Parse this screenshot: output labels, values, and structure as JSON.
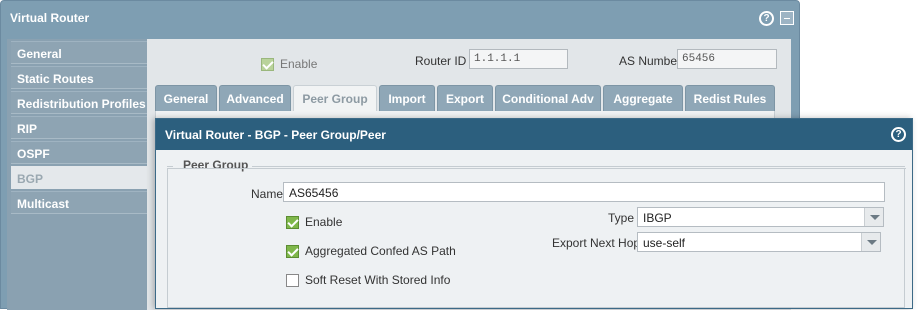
{
  "window": {
    "title": "Virtual Router"
  },
  "sidebar": {
    "items": [
      {
        "label": "General"
      },
      {
        "label": "Static Routes"
      },
      {
        "label": "Redistribution Profiles"
      },
      {
        "label": "RIP"
      },
      {
        "label": "OSPF"
      },
      {
        "label": "BGP"
      },
      {
        "label": "Multicast"
      }
    ],
    "active": "BGP"
  },
  "bgp_settings": {
    "enable_label": "Enable",
    "enable_checked": true,
    "router_id_label": "Router ID",
    "router_id_value": "1.1.1.1",
    "as_number_label": "AS Number",
    "as_number_value": "65456"
  },
  "tabs": [
    {
      "label": "General"
    },
    {
      "label": "Advanced"
    },
    {
      "label": "Peer Group"
    },
    {
      "label": "Import"
    },
    {
      "label": "Export"
    },
    {
      "label": "Conditional Adv"
    },
    {
      "label": "Aggregate"
    },
    {
      "label": "Redist Rules"
    }
  ],
  "active_tab": "Peer Group",
  "dialog": {
    "title": "Virtual Router - BGP - Peer Group/Peer",
    "section_title": "Peer Group",
    "name_label": "Name",
    "name_value": "AS65456",
    "enable_label": "Enable",
    "enable_checked": true,
    "aggregated_label": "Aggregated Confed AS Path",
    "aggregated_checked": true,
    "soft_reset_label": "Soft Reset With Stored Info",
    "soft_reset_checked": false,
    "type_label": "Type",
    "type_value": "IBGP",
    "export_next_hop_label": "Export Next Hop",
    "export_next_hop_value": "use-self"
  }
}
